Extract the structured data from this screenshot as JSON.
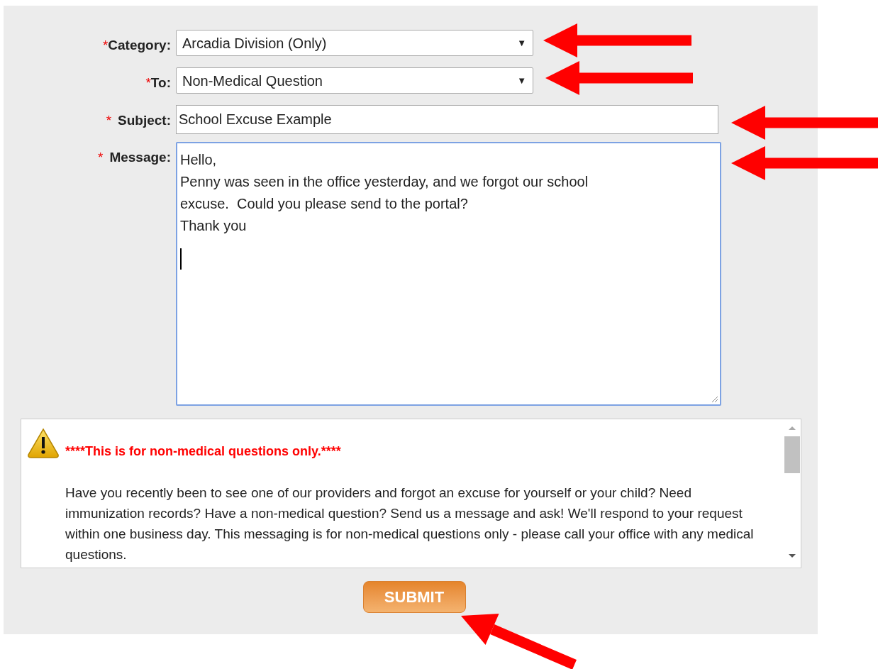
{
  "form": {
    "fields": [
      {
        "kind": "select",
        "required_mark": "*",
        "label": "Category:",
        "value": "Arcadia Division (Only)",
        "arrow": "▼"
      },
      {
        "kind": "select",
        "required_mark": "*",
        "label": "To:",
        "value": "Non-Medical Question",
        "arrow": "▼"
      },
      {
        "kind": "text",
        "required_mark": "*",
        "label": "Subject:",
        "value": "School Excuse Example"
      },
      {
        "kind": "textarea",
        "required_mark": "*",
        "label": "Message:",
        "lines": [
          "Hello,",
          "Penny was seen in the office yesterday, and we forgot our school",
          "excuse.  Could you please send to the portal?",
          "Thank you"
        ]
      }
    ]
  },
  "notice": {
    "heading": "****This is for non-medical questions only.****",
    "body": "Have you recently been to see one of our providers and forgot an excuse for yourself or your child? Need immunization records? Have a non-medical question? Send us a message and ask! We'll respond to your request within one business day. This messaging is for non-medical questions only - please call your office with any medical questions."
  },
  "submit": {
    "label": "SUBMIT"
  }
}
